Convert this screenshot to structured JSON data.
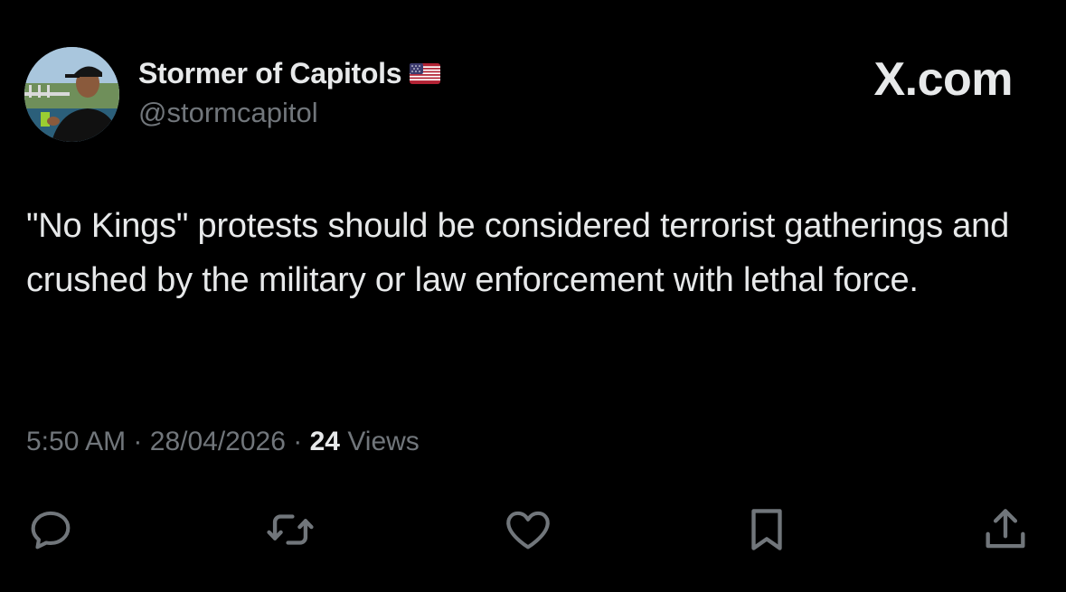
{
  "author": {
    "display_name": "Stormer of Capitols",
    "handle": "@stormcapitol",
    "flag_icon": "us-flag-icon"
  },
  "brand": "X.com",
  "tweet": {
    "text": "\"No Kings\" protests should be considered terrorist gatherings and crushed by the military or law enforcement with lethal force.",
    "time": "5:50 AM",
    "separator": "·",
    "date": "28/04/2026",
    "views_count": "24",
    "views_label": "Views"
  },
  "actions": [
    {
      "name": "reply",
      "icon": "reply-icon"
    },
    {
      "name": "repost",
      "icon": "repost-icon"
    },
    {
      "name": "like",
      "icon": "heart-icon"
    },
    {
      "name": "bookmark",
      "icon": "bookmark-icon"
    },
    {
      "name": "share",
      "icon": "share-icon"
    }
  ],
  "colors": {
    "background": "#000000",
    "primary_text": "#e7e9ea",
    "secondary_text": "#71767b"
  }
}
